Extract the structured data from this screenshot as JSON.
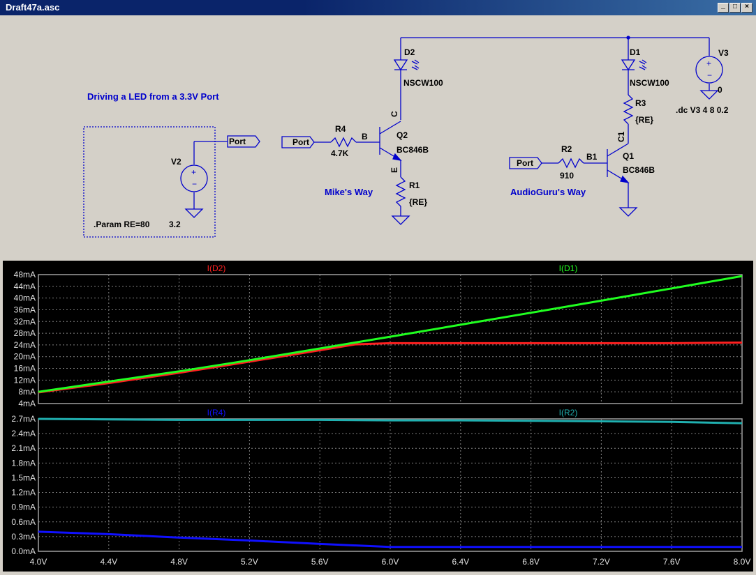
{
  "window": {
    "title": "Draft47a.asc",
    "btn_min": "_",
    "btn_max": "□",
    "btn_close": "×"
  },
  "schematic": {
    "heading": "Driving a LED from a 3.3V Port",
    "param": ".Param RE=80",
    "param_value": "3.2",
    "dc_command": ".dc V3 4 8 0.2",
    "left_label": "Mike's Way",
    "right_label": "AudioGuru's Way",
    "port_label": "Port",
    "v2": "V2",
    "v3": "V3",
    "v3_ground": "0",
    "d2": "D2",
    "d2_model": "NSCW100",
    "d1": "D1",
    "d1_model": "NSCW100",
    "r4": "R4",
    "r4_value": "4.7K",
    "r1": "R1",
    "r1_value": "{RE}",
    "r2": "R2",
    "r2_value": "910",
    "r3": "R3",
    "r3_value": "{RE}",
    "q2": "Q2",
    "q2_model": "BC846B",
    "q1": "Q1",
    "q1_model": "BC846B",
    "node_b": "B",
    "node_c": "C",
    "node_e": "E",
    "node_b1": "B1",
    "node_c1": "C1"
  },
  "colors": {
    "red": "#ff2020",
    "green": "#20ff20",
    "blue": "#1010ff",
    "cyan": "#20b0b0",
    "schematic_blue": "#0000cc",
    "grid": "#808080"
  },
  "chart_data": [
    {
      "type": "line",
      "title": "",
      "xlabel": "",
      "ylabel": "",
      "x": [
        4.0,
        4.4,
        4.8,
        5.2,
        5.6,
        5.8,
        6.0,
        6.4,
        6.8,
        7.2,
        7.6,
        8.0
      ],
      "xlim": [
        4.0,
        8.0
      ],
      "ylim": [
        4,
        48
      ],
      "x_ticks": [
        "4.0V",
        "4.4V",
        "4.8V",
        "5.2V",
        "5.6V",
        "6.0V",
        "6.4V",
        "6.8V",
        "7.2V",
        "7.6V",
        "8.0V"
      ],
      "y_ticks": [
        "48mA",
        "44mA",
        "40mA",
        "36mA",
        "32mA",
        "28mA",
        "24mA",
        "20mA",
        "16mA",
        "12mA",
        "8mA",
        "4mA"
      ],
      "series": [
        {
          "name": "I(D2)",
          "color": "#ff2020",
          "values": [
            7.8,
            11.0,
            14.5,
            18.3,
            22.2,
            24.2,
            24.6,
            24.6,
            24.6,
            24.6,
            24.6,
            24.8
          ]
        },
        {
          "name": "I(D1)",
          "color": "#20ff20",
          "values": [
            8.0,
            11.5,
            15.0,
            18.8,
            22.8,
            24.8,
            26.8,
            30.9,
            35.0,
            39.1,
            43.3,
            47.5
          ]
        }
      ]
    },
    {
      "type": "line",
      "title": "",
      "xlabel": "",
      "ylabel": "",
      "x": [
        4.0,
        4.4,
        4.8,
        5.2,
        5.6,
        6.0,
        6.4,
        6.8,
        7.2,
        7.6,
        8.0
      ],
      "xlim": [
        4.0,
        8.0
      ],
      "ylim": [
        0.0,
        2.7
      ],
      "x_ticks": [
        "4.0V",
        "4.4V",
        "4.8V",
        "5.2V",
        "5.6V",
        "6.0V",
        "6.4V",
        "6.8V",
        "7.2V",
        "7.6V",
        "8.0V"
      ],
      "y_ticks": [
        "2.7mA",
        "2.4mA",
        "2.1mA",
        "1.8mA",
        "1.5mA",
        "1.2mA",
        "0.9mA",
        "0.6mA",
        "0.3mA",
        "0.0mA"
      ],
      "series": [
        {
          "name": "I(R4)",
          "color": "#1010ff",
          "values": [
            0.4,
            0.35,
            0.28,
            0.22,
            0.15,
            0.09,
            0.09,
            0.09,
            0.09,
            0.09,
            0.09
          ]
        },
        {
          "name": "I(R2)",
          "color": "#20b0b0",
          "values": [
            2.7,
            2.69,
            2.68,
            2.68,
            2.68,
            2.67,
            2.67,
            2.66,
            2.65,
            2.64,
            2.61
          ]
        }
      ]
    }
  ]
}
